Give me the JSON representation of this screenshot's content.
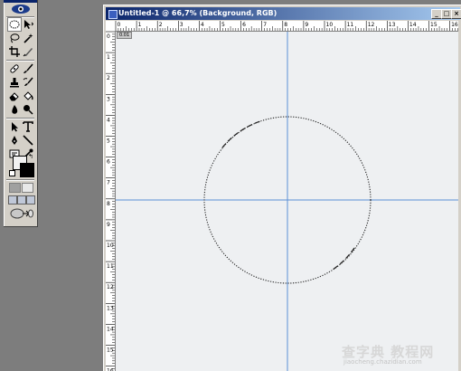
{
  "window": {
    "title": "Untitled-1 @ 66,7% (Background, RGB)",
    "controls": {
      "minimize": "_",
      "restore": "□",
      "close": "×"
    }
  },
  "rulers": {
    "top_labels": [
      "0",
      "1",
      "2",
      "3",
      "4",
      "5",
      "6",
      "7",
      "8",
      "9",
      "10",
      "11",
      "12",
      "13",
      "14",
      "15",
      "16"
    ],
    "left_labels": [
      "0",
      "1",
      "2",
      "3",
      "4",
      "5",
      "6",
      "7",
      "8",
      "9",
      "10",
      "11",
      "12",
      "13",
      "14",
      "15",
      "16"
    ],
    "origin_badge": "0.01"
  },
  "toolbox": {
    "tools": [
      "marquee-icon",
      "move-icon",
      "lasso-icon",
      "magic-wand-icon",
      "crop-icon",
      "slice-icon",
      "healing-brush-icon",
      "brush-icon",
      "clone-stamp-icon",
      "history-brush-icon",
      "eraser-icon",
      "paint-bucket-icon",
      "blur-icon",
      "dodge-icon",
      "path-selection-icon",
      "type-icon",
      "pen-icon",
      "line-shape-icon",
      "notes-icon",
      "eyedropper-icon",
      "hand-icon",
      "zoom-icon"
    ],
    "foreground_color": "#f1f1f1",
    "background_color": "#000000"
  },
  "canvas": {
    "background_color": "#eef0f2",
    "guide_color": "#5b8fd6"
  },
  "watermark": {
    "main": "查字典 教程网",
    "url": "jiaocheng.chazidian.com"
  }
}
